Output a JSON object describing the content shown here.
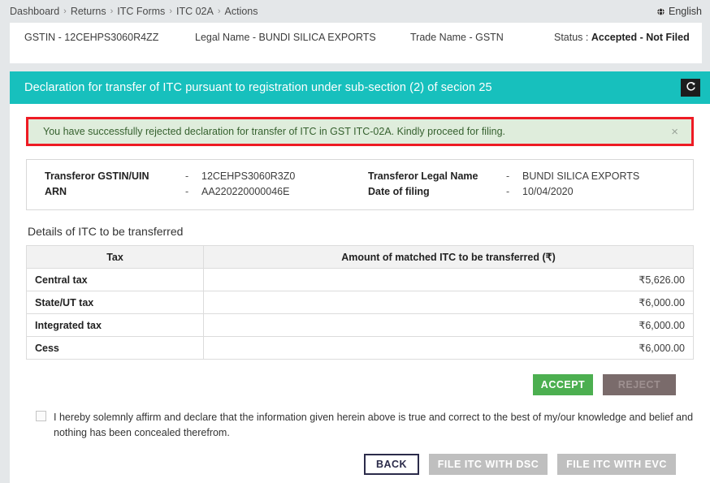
{
  "breadcrumb": {
    "items": [
      "Dashboard",
      "Returns",
      "ITC Forms",
      "ITC 02A",
      "Actions"
    ],
    "separator": "›"
  },
  "language": {
    "icon": "globe-icon",
    "label": "English"
  },
  "taxpayer": {
    "gstin": "GSTIN - 12CEHPS3060R4ZZ",
    "legal_name": "Legal Name - BUNDI SILICA EXPORTS",
    "trade_name": "Trade Name - GSTN",
    "status_label": "Status : ",
    "status_value": "Accepted - Not Filed"
  },
  "band": {
    "title": "Declaration for transfer of ITC pursuant to registration under sub-section (2) of secion 25",
    "refresh_icon": "refresh-icon",
    "color": "#17c0bd"
  },
  "alert": {
    "message": "You have successfully rejected declaration for transfer of ITC in GST ITC-02A. Kindly proceed for filing.",
    "close_icon": "×",
    "background": "#dfeddc",
    "border_color": "#ee1b24",
    "text_color": "#36612f"
  },
  "transferor": {
    "rows": [
      {
        "label": "Transferor GSTIN/UIN",
        "dash": "-",
        "value": "12CEHPS3060R3Z0",
        "label2": "Transferor Legal Name",
        "dash2": "-",
        "value2": "BUNDI SILICA EXPORTS"
      },
      {
        "label": "ARN",
        "dash": "-",
        "value": "AA220220000046E",
        "label2": "Date of filing",
        "dash2": "-",
        "value2": "10/04/2020"
      }
    ]
  },
  "section": {
    "title": "Details of ITC to be transferred"
  },
  "table": {
    "headers": [
      "Tax",
      "Amount of matched ITC to be transferred (₹)"
    ],
    "rows": [
      {
        "tax": "Central tax",
        "amount": "₹5,626.00"
      },
      {
        "tax": "State/UT tax",
        "amount": "₹6,000.00"
      },
      {
        "tax": "Integrated tax",
        "amount": "₹6,000.00"
      },
      {
        "tax": "Cess",
        "amount": "₹6,000.00"
      }
    ]
  },
  "actions": {
    "accept_label": "ACCEPT",
    "reject_label": "REJECT",
    "accept_color": "#4caf50",
    "reject_color": "#7a6b6b"
  },
  "declaration": {
    "checked": false,
    "text": "I hereby solemnly affirm and declare that the information given herein above is true and correct to the best of my/our knowledge and belief and nothing has been concealed therefrom."
  },
  "footer": {
    "back_label": "BACK",
    "dsc_label": "FILE ITC WITH DSC",
    "evc_label": "FILE ITC WITH EVC"
  }
}
